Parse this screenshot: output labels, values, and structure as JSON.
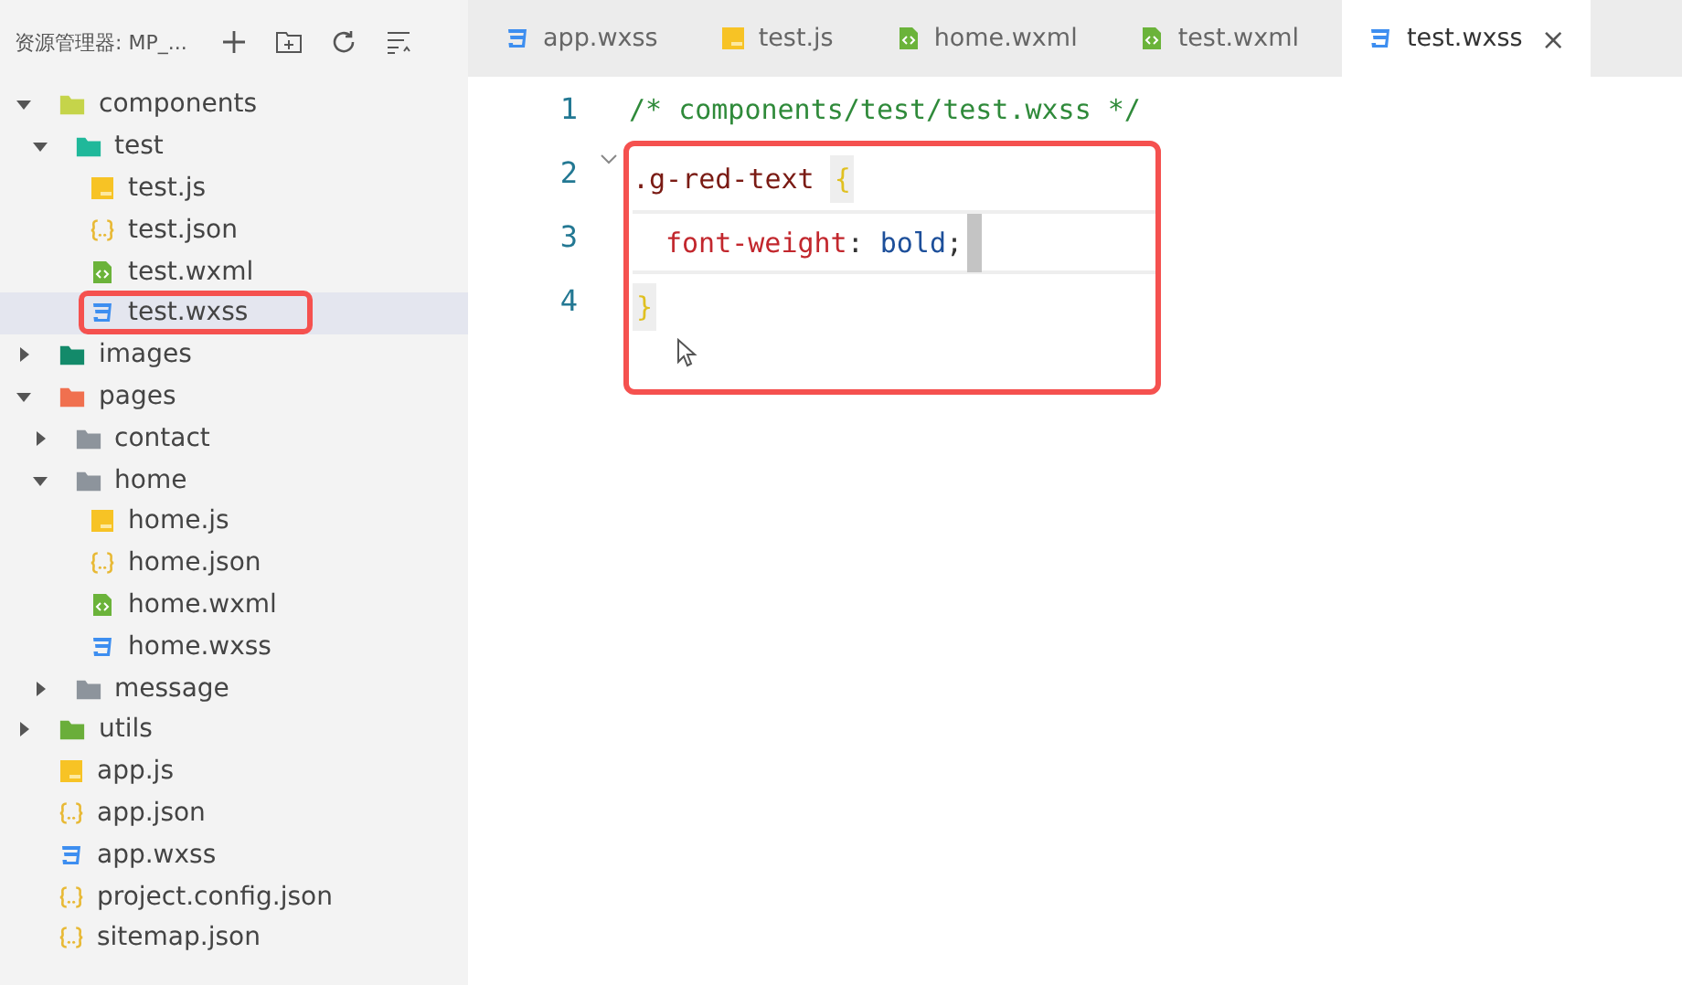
{
  "sidebar": {
    "title": "资源管理器: MP_...",
    "tree": [
      {
        "label": "components",
        "kind": "folder",
        "color": "#c5d44a",
        "expanded": true,
        "children": [
          {
            "label": "test",
            "kind": "folder",
            "color": "#1fb89a",
            "expanded": true,
            "children": [
              {
                "label": "test.js",
                "kind": "js",
                "selected": false,
                "marked": false
              },
              {
                "label": "test.json",
                "kind": "json",
                "selected": false,
                "marked": false
              },
              {
                "label": "test.wxml",
                "kind": "wxml",
                "selected": false,
                "marked": false
              },
              {
                "label": "test.wxss",
                "kind": "wxss",
                "selected": true,
                "marked": true
              }
            ]
          }
        ]
      },
      {
        "label": "images",
        "kind": "folder",
        "color": "#138a6a",
        "expanded": false
      },
      {
        "label": "pages",
        "kind": "folder",
        "color": "#f0704f",
        "expanded": true,
        "children": [
          {
            "label": "contact",
            "kind": "folder",
            "color": "#8d949c",
            "expanded": false
          },
          {
            "label": "home",
            "kind": "folder",
            "color": "#8d949c",
            "expanded": true,
            "children": [
              {
                "label": "home.js",
                "kind": "js",
                "selected": false,
                "marked": false
              },
              {
                "label": "home.json",
                "kind": "json",
                "selected": false,
                "marked": false
              },
              {
                "label": "home.wxml",
                "kind": "wxml",
                "selected": false,
                "marked": false
              },
              {
                "label": "home.wxss",
                "kind": "wxss",
                "selected": false,
                "marked": false
              }
            ]
          },
          {
            "label": "message",
            "kind": "folder",
            "color": "#8d949c",
            "expanded": false
          }
        ]
      },
      {
        "label": "utils",
        "kind": "folder",
        "color": "#6aae3a",
        "expanded": false
      },
      {
        "label": "app.js",
        "kind": "js",
        "selected": false,
        "marked": false
      },
      {
        "label": "app.json",
        "kind": "json",
        "selected": false,
        "marked": false
      },
      {
        "label": "app.wxss",
        "kind": "wxss",
        "selected": false,
        "marked": false
      },
      {
        "label": "project.config.json",
        "kind": "json",
        "selected": false,
        "marked": false
      },
      {
        "label": "sitemap.json",
        "kind": "json",
        "selected": false,
        "marked": false
      }
    ]
  },
  "tabs": [
    {
      "label": "app.wxss",
      "kind": "wxss",
      "selected": false
    },
    {
      "label": "test.js",
      "kind": "js",
      "selected": false
    },
    {
      "label": "home.wxml",
      "kind": "wxml",
      "selected": false
    },
    {
      "label": "test.wxml",
      "kind": "wxml",
      "selected": false
    },
    {
      "label": "test.wxss",
      "kind": "wxss",
      "selected": true,
      "close": "×"
    }
  ],
  "editor": {
    "lines": [
      {
        "number": "1",
        "current": false,
        "tokens": [
          {
            "text": "/* components/test/test.wxss */",
            "kind": "comment"
          }
        ]
      }
    ],
    "highlighted_block": {
      "lines": [
        {
          "number": "2",
          "current": false,
          "tokens": [
            {
              "text": ".g-red-text",
              "kind": "selector"
            },
            {
              "text": "{",
              "kind": "bracket"
            }
          ],
          "children": [
            {
              "number": "3",
              "current": true,
              "tokens": [
                {
                  "text": "font-weight",
                  "kind": "property"
                },
                {
                  "text": ":",
                  "kind": "punct"
                },
                {
                  "text": "bold",
                  "kind": "value"
                },
                {
                  "text": ";",
                  "kind": "punct"
                }
              ]
            }
          ]
        },
        {
          "number": "4",
          "current": false,
          "tokens": [
            {
              "text": "}",
              "kind": "bracket"
            }
          ]
        }
      ]
    }
  }
}
